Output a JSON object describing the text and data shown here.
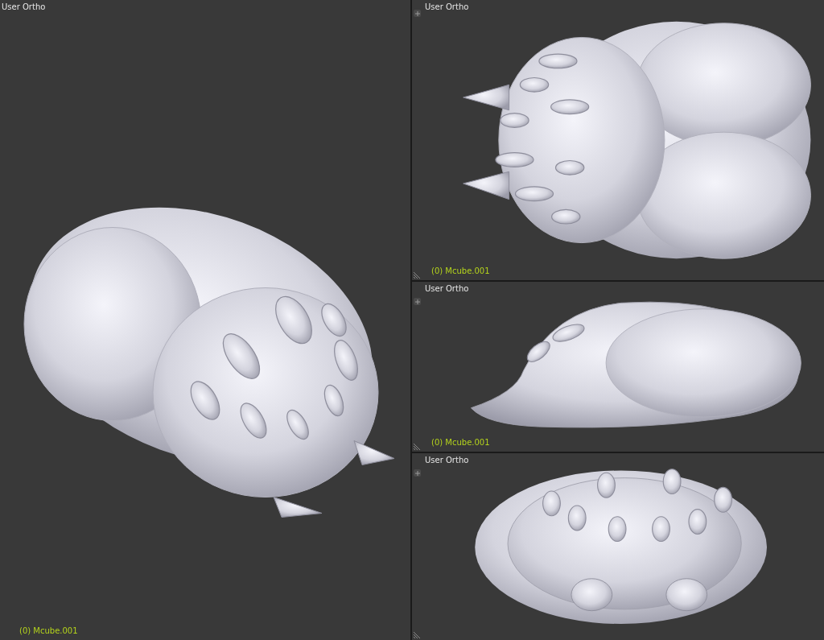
{
  "viewports": [
    {
      "kind": "perspective",
      "title": "User Ortho",
      "object_label": "(0) Mcube.001"
    },
    {
      "kind": "top",
      "title": "User Ortho",
      "object_label": "(0) Mcube.001"
    },
    {
      "kind": "side",
      "title": "User Ortho",
      "object_label": "(0) Mcube.001"
    },
    {
      "kind": "front",
      "title": "User Ortho"
    }
  ]
}
